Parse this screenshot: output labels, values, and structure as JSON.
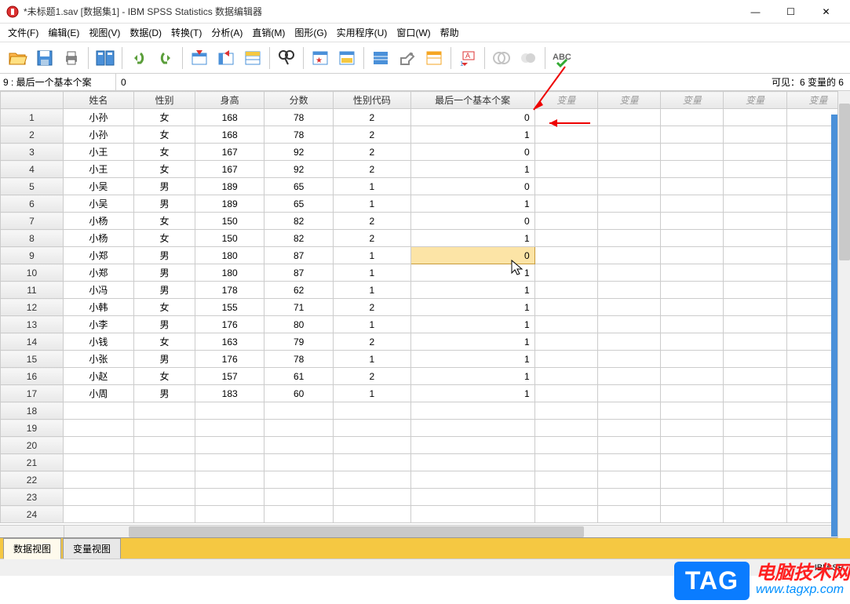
{
  "window": {
    "title": "*未标题1.sav [数据集1] - IBM SPSS Statistics 数据编辑器",
    "min": "—",
    "max": "☐",
    "close": "✕"
  },
  "menu": [
    "文件(F)",
    "编辑(E)",
    "视图(V)",
    "数据(D)",
    "转换(T)",
    "分析(A)",
    "直销(M)",
    "图形(G)",
    "实用程序(U)",
    "窗口(W)",
    "帮助"
  ],
  "cellref": "9 : 最后一个基本个案",
  "cellval": "0",
  "visible_info": "可见：6 变量的 6",
  "columns": [
    "姓名",
    "性别",
    "身高",
    "分数",
    "性别代码",
    "最后一个基本个案"
  ],
  "empty_col": "变量",
  "rows": [
    {
      "n": "1",
      "name": "小孙",
      "gender": "女",
      "height": "168",
      "score": "78",
      "gcode": "2",
      "last": "0"
    },
    {
      "n": "2",
      "name": "小孙",
      "gender": "女",
      "height": "168",
      "score": "78",
      "gcode": "2",
      "last": "1"
    },
    {
      "n": "3",
      "name": "小王",
      "gender": "女",
      "height": "167",
      "score": "92",
      "gcode": "2",
      "last": "0"
    },
    {
      "n": "4",
      "name": "小王",
      "gender": "女",
      "height": "167",
      "score": "92",
      "gcode": "2",
      "last": "1"
    },
    {
      "n": "5",
      "name": "小吴",
      "gender": "男",
      "height": "189",
      "score": "65",
      "gcode": "1",
      "last": "0"
    },
    {
      "n": "6",
      "name": "小吴",
      "gender": "男",
      "height": "189",
      "score": "65",
      "gcode": "1",
      "last": "1"
    },
    {
      "n": "7",
      "name": "小杨",
      "gender": "女",
      "height": "150",
      "score": "82",
      "gcode": "2",
      "last": "0"
    },
    {
      "n": "8",
      "name": "小杨",
      "gender": "女",
      "height": "150",
      "score": "82",
      "gcode": "2",
      "last": "1"
    },
    {
      "n": "9",
      "name": "小郑",
      "gender": "男",
      "height": "180",
      "score": "87",
      "gcode": "1",
      "last": "0"
    },
    {
      "n": "10",
      "name": "小郑",
      "gender": "男",
      "height": "180",
      "score": "87",
      "gcode": "1",
      "last": "1"
    },
    {
      "n": "11",
      "name": "小冯",
      "gender": "男",
      "height": "178",
      "score": "62",
      "gcode": "1",
      "last": "1"
    },
    {
      "n": "12",
      "name": "小韩",
      "gender": "女",
      "height": "155",
      "score": "71",
      "gcode": "2",
      "last": "1"
    },
    {
      "n": "13",
      "name": "小李",
      "gender": "男",
      "height": "176",
      "score": "80",
      "gcode": "1",
      "last": "1"
    },
    {
      "n": "14",
      "name": "小钱",
      "gender": "女",
      "height": "163",
      "score": "79",
      "gcode": "2",
      "last": "1"
    },
    {
      "n": "15",
      "name": "小张",
      "gender": "男",
      "height": "176",
      "score": "78",
      "gcode": "1",
      "last": "1"
    },
    {
      "n": "16",
      "name": "小赵",
      "gender": "女",
      "height": "157",
      "score": "61",
      "gcode": "2",
      "last": "1"
    },
    {
      "n": "17",
      "name": "小周",
      "gender": "男",
      "height": "183",
      "score": "60",
      "gcode": "1",
      "last": "1"
    }
  ],
  "empty_rows": [
    "18",
    "19",
    "20",
    "21",
    "22",
    "23",
    "24"
  ],
  "tabs": {
    "data": "数据视图",
    "var": "变量视图"
  },
  "bottom_status": "IBM SP",
  "watermark": {
    "tag": "TAG",
    "zh": "电脑技术网",
    "url": "www.tagxp.com"
  }
}
